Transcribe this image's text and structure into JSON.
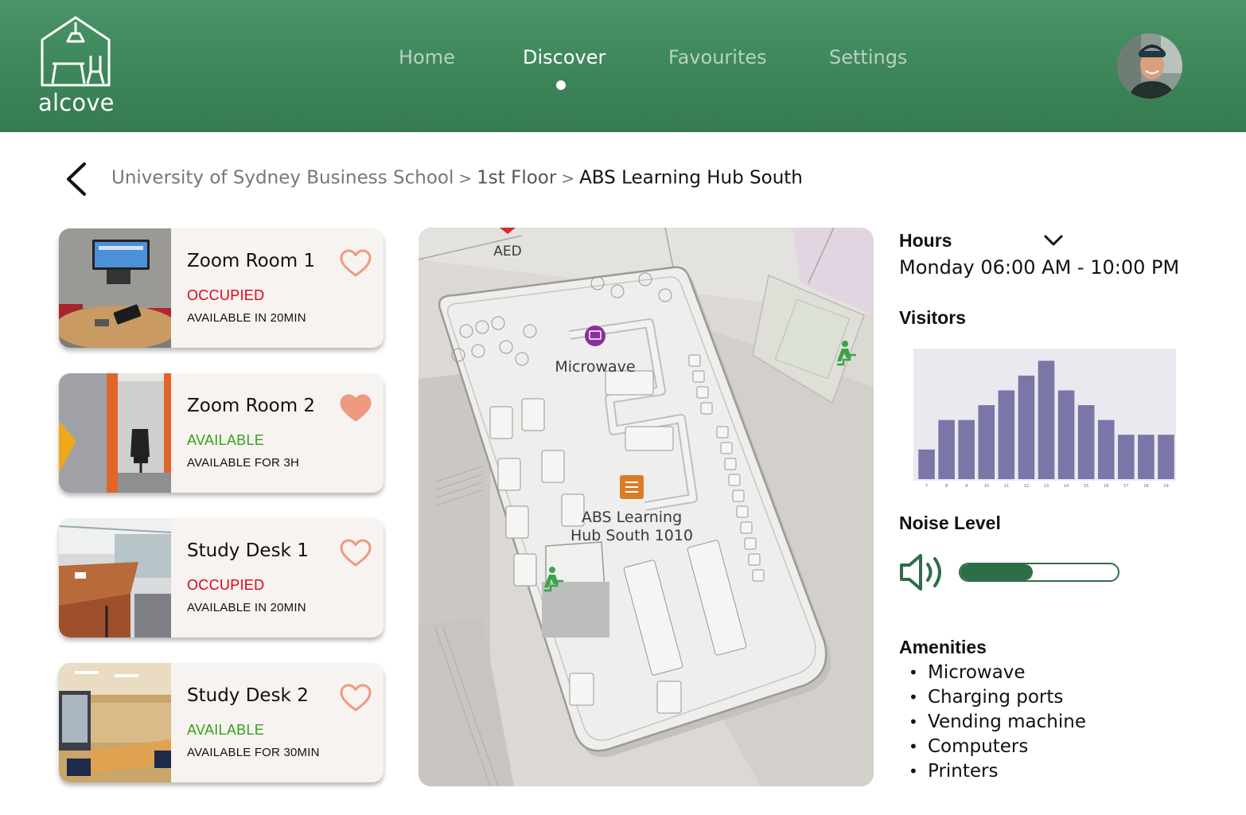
{
  "app": {
    "name": "alcove"
  },
  "nav": {
    "items": [
      {
        "label": "Home",
        "active": false
      },
      {
        "label": "Discover",
        "active": true
      },
      {
        "label": "Favourites",
        "active": false
      },
      {
        "label": "Settings",
        "active": false
      }
    ]
  },
  "breadcrumb": {
    "items": [
      "University of Sydney Business School",
      "1st Floor",
      "ABS Learning Hub South"
    ],
    "separator": ">"
  },
  "spaces": [
    {
      "title": "Zoom Room 1",
      "status": "OCCUPIED",
      "detail": "AVAILABLE IN 20MIN",
      "favourite": false
    },
    {
      "title": "Zoom Room 2",
      "status": "AVAILABLE",
      "detail": "AVAILABLE FOR 3H",
      "favourite": true
    },
    {
      "title": "Study Desk 1",
      "status": "OCCUPIED",
      "detail": "AVAILABLE IN 20MIN",
      "favourite": false
    },
    {
      "title": "Study Desk 2",
      "status": "AVAILABLE",
      "detail": "AVAILABLE FOR 30MIN",
      "favourite": false
    }
  ],
  "map": {
    "labels": {
      "aed": "AED",
      "microwave": "Microwave",
      "hub_line1": "ABS Learning",
      "hub_line2": "Hub South 1010"
    }
  },
  "hours": {
    "heading": "Hours",
    "value": "Monday 06:00 AM - 10:00 PM"
  },
  "visitors": {
    "heading": "Visitors"
  },
  "noise": {
    "heading": "Noise Level",
    "level": 0.46
  },
  "amenities": {
    "heading": "Amenities",
    "items": [
      "Microwave",
      "Charging ports",
      "Vending machine",
      "Computers",
      "Printers"
    ]
  },
  "colors": {
    "brand": "#3d8659",
    "occupied": "#e0001b",
    "available": "#36a01a",
    "heart": "#ee9a7e",
    "bar": "#7b76a8"
  },
  "chart_data": {
    "type": "bar",
    "categories": [
      "7",
      "8",
      "9",
      "10",
      "11",
      "12",
      "13",
      "14",
      "15",
      "16",
      "17",
      "18",
      "19"
    ],
    "values": [
      2,
      4,
      4,
      5,
      6,
      7,
      8,
      6,
      5,
      4,
      3,
      3,
      3
    ],
    "ylim": [
      0,
      8.5
    ],
    "grid": false
  }
}
